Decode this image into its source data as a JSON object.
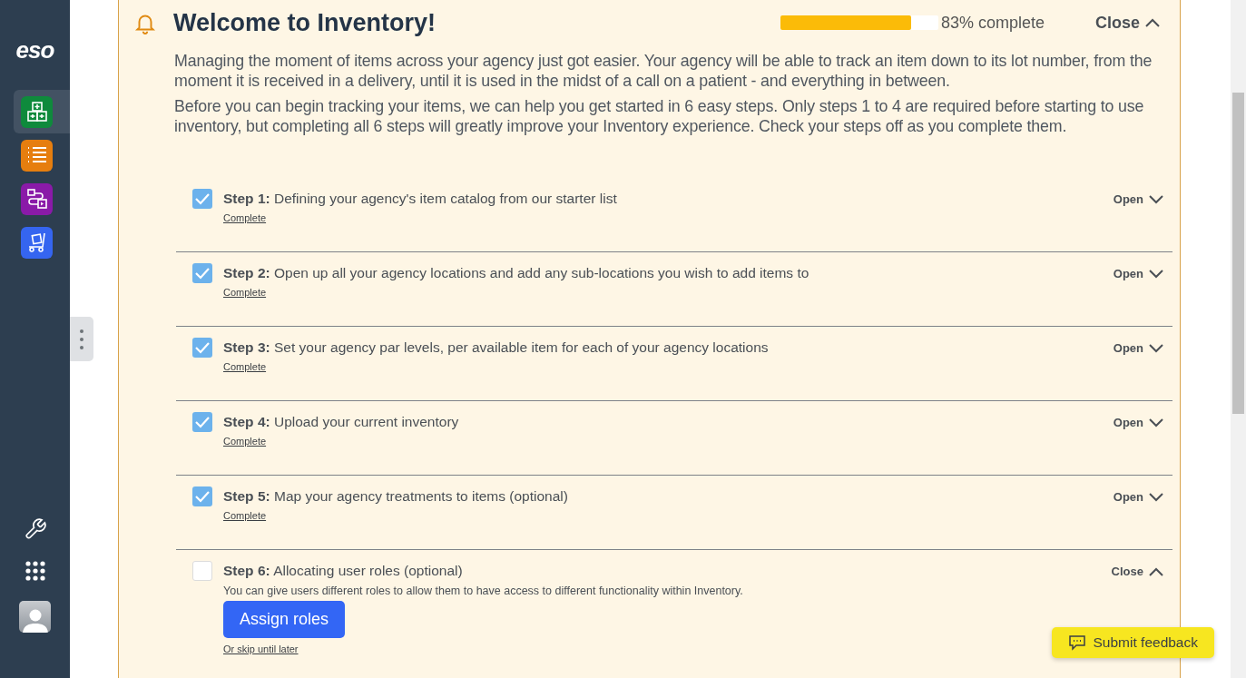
{
  "sidebar": {
    "logo": "eso",
    "apps": [
      {
        "kind": "boxes",
        "color": "#0f8a3c",
        "selected": true
      },
      {
        "kind": "list",
        "color": "#e67e0f",
        "selected": false
      },
      {
        "kind": "flow",
        "color": "#8a1aa8",
        "selected": false
      },
      {
        "kind": "cart",
        "color": "#3565f0",
        "selected": false
      }
    ]
  },
  "welcome": {
    "title": "Welcome to Inventory!",
    "progress": {
      "level": 0.83,
      "label": "83% complete"
    },
    "close": "Close",
    "paragraphs": [
      "Managing the moment of items across your agency just got easier. Your agency will be able to track an item down to its lot number, from the moment it is received in a delivery, until it is used in the midst of a call on a patient - and everything in between.",
      "Before you can begin tracking your items, we can help you get started in 6 easy steps. Only steps 1 to 4 are required before starting to use inventory, but completing all 6 steps will greatly improve your Inventory experience. Check your steps off as you complete them."
    ],
    "steps": [
      {
        "title": "**Step 1:** Defining your agency's item catalog from our starter list",
        "checked": true,
        "status": "Complete",
        "toggle": "Open",
        "expanded": false
      },
      {
        "title": "**Step 2:** Open up all your agency locations and add any sub-locations you wish to add items to",
        "checked": true,
        "status": "Complete",
        "toggle": "Open",
        "expanded": false
      },
      {
        "title": "**Step 3:** Set your agency par levels, per available item for each of your agency locations",
        "checked": true,
        "status": "Complete",
        "toggle": "Open",
        "expanded": false
      },
      {
        "title": "**Step 4:** Upload your current inventory",
        "checked": true,
        "status": "Complete",
        "toggle": "Open",
        "expanded": false
      },
      {
        "title": "**Step 5:** Map your agency treatments to items (optional)",
        "checked": true,
        "status": "Complete",
        "toggle": "Open",
        "expanded": false
      },
      {
        "title": "**Step 6:** Allocating user roles (optional)",
        "checked": false,
        "toggle": "Close",
        "expanded": true,
        "description": "You can give users different roles to allow them to have access to different functionality within Inventory.",
        "button": "Assign roles",
        "skip": "Or skip until later"
      }
    ]
  },
  "feedback": {
    "label": "Submit feedback"
  }
}
